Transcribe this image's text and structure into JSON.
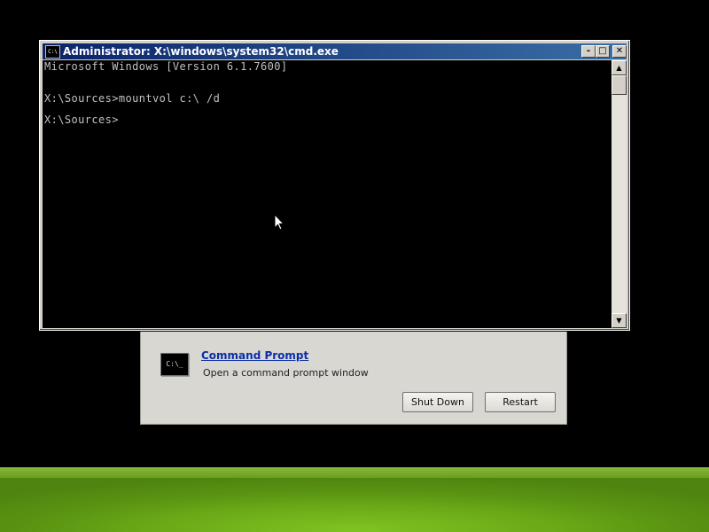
{
  "cmd_window": {
    "title": "Administrator: X:\\windows\\system32\\cmd.exe",
    "icon_text": "C:\\",
    "lines": [
      "Microsoft Windows [Version 6.1.7600]",
      "X:\\Sources>mountvol c:\\ /d",
      "X:\\Sources>"
    ],
    "buttons": {
      "minimize": "-",
      "maximize": "□",
      "close": "✕"
    },
    "scroll_up": "▲",
    "scroll_down": "▼"
  },
  "recovery": {
    "tool_title": "Command Prompt",
    "tool_description": "Open a command prompt window",
    "tool_icon_text": "C:\\_",
    "shutdown_label": "Shut Down",
    "restart_label": "Restart"
  }
}
